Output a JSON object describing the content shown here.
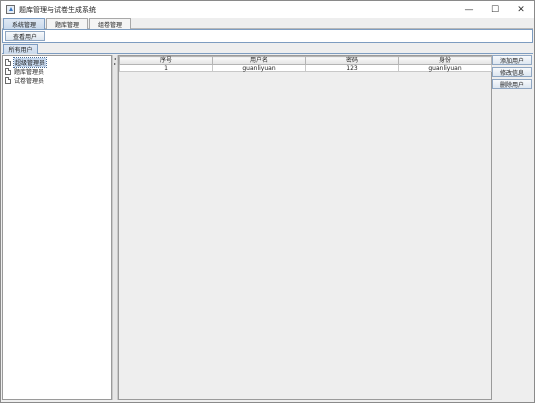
{
  "window": {
    "title": "题库管理与试卷生成系统",
    "controls": {
      "minimize": "—",
      "maximize": "☐",
      "close": "✕"
    }
  },
  "menu_tabs": [
    {
      "label": "系统管理",
      "active": true
    },
    {
      "label": "题库管理",
      "active": false
    },
    {
      "label": "组卷管理",
      "active": false
    }
  ],
  "toolbar": {
    "view_users_label": "查看用户"
  },
  "subtab": {
    "label": "所有用户"
  },
  "tree": {
    "items": [
      {
        "label": "超级管理员",
        "selected": true,
        "icon": "document-icon"
      },
      {
        "label": "题库管理员",
        "selected": false,
        "icon": "document-icon"
      },
      {
        "label": "试卷管理员",
        "selected": false,
        "icon": "document-icon"
      }
    ]
  },
  "table": {
    "columns": [
      "序号",
      "用户名",
      "密码",
      "身份"
    ],
    "rows": [
      [
        "1",
        "guanliyuan",
        "123",
        "guanliyuan"
      ]
    ]
  },
  "actions": {
    "add_user": "添加用户",
    "edit_info": "修改信息",
    "delete_user": "删除用户"
  },
  "colors": {
    "selected_tab": "#c9d9ec",
    "accent_border": "#7d9cc0",
    "selection": "#c6d8ee"
  }
}
